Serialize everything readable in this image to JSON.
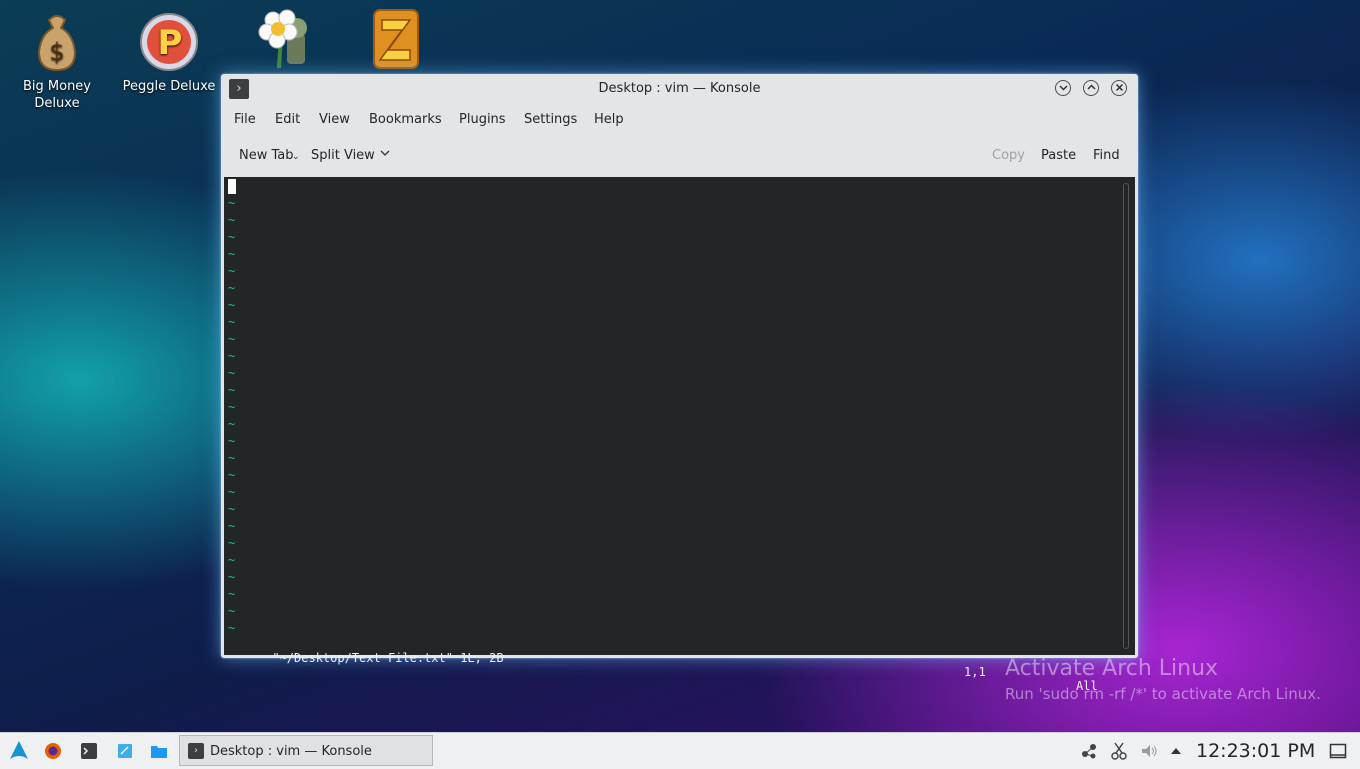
{
  "desktop": {
    "icons": [
      {
        "label": "Big Money\nDeluxe",
        "line1": "Big Money",
        "line2": "Deluxe",
        "icon": "money-bag-icon"
      },
      {
        "label": "Peggle Deluxe",
        "icon": "peggle-icon"
      },
      {
        "label": "",
        "icon": "flower-zombie-icon"
      },
      {
        "label": "",
        "icon": "zuma-icon"
      }
    ],
    "watermark": {
      "title": "Activate Arch Linux",
      "subtitle": "Run 'sudo rm -rf /*' to activate Arch Linux."
    }
  },
  "window": {
    "title": "Desktop : vim — Konsole",
    "menu": [
      "File",
      "Edit",
      "View",
      "Bookmarks",
      "Plugins",
      "Settings",
      "Help"
    ],
    "toolbar": {
      "new_tab": "New Tab",
      "split_view": "Split View",
      "copy": "Copy",
      "paste": "Paste",
      "find": "Find"
    },
    "terminal": {
      "tilde": "~",
      "status_file": "\"~/Desktop/Text File.txt\" 1L, 2B",
      "status_pos": "1,1",
      "status_scroll": "All"
    }
  },
  "taskbar": {
    "task_label": "Desktop : vim — Konsole",
    "clock": "12:23:01 PM"
  },
  "colors": {
    "terminal_bg": "#232627",
    "tilde": "#1abc9c",
    "window_chrome": "#e3e5e7",
    "taskbar": "#eff0f1"
  }
}
